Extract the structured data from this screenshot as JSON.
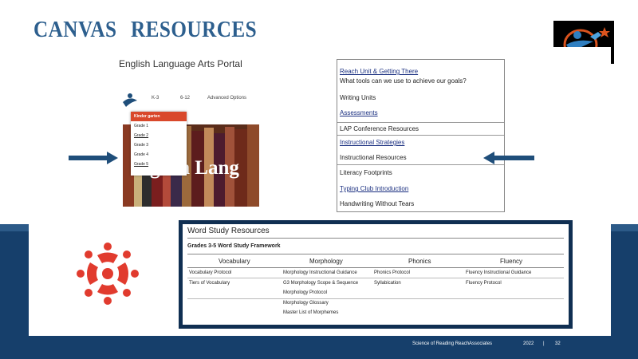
{
  "header": {
    "title_left": "CANVAS",
    "title_right": "RESOURCES"
  },
  "portal": {
    "title": "English Language Arts Portal",
    "nav": [
      "K-3",
      "6-12",
      "Advanced Options"
    ],
    "dropdown_head": "Kinder garten",
    "dropdown_items": [
      "Grade 1",
      "Grade 2",
      "Grade 3",
      "Grade 4",
      "Grade 5"
    ],
    "photo_text": "glish Lang"
  },
  "list": {
    "items": [
      {
        "label": "Reach Unit & Getting There",
        "link": true
      },
      {
        "label": "What tools can we use to achieve our goals?",
        "link": false
      },
      {
        "label": "Writing Units",
        "link": false
      },
      {
        "label": "Assessments",
        "link": true
      },
      {
        "label": "LAP Conference Resources",
        "link": false
      },
      {
        "label": "Instructional Strategies",
        "link": true
      },
      {
        "label": "Instructional Resources",
        "link": false
      },
      {
        "label": "Literacy Footprints",
        "link": false
      },
      {
        "label": "Typing Club Introduction",
        "link": true
      },
      {
        "label": "Handwriting Without Tears",
        "link": false
      }
    ]
  },
  "word_study": {
    "title": "Word Study Resources",
    "subtitle": "Grades 3-5 Word Study Framework",
    "headers": [
      "Vocabulary",
      "Morphology",
      "Phonics",
      "Fluency"
    ],
    "vocabulary": [
      "Vocabulary Protocol",
      "Tiers of Vocabulary"
    ],
    "morphology": [
      "Morphology Instructional Guidance",
      "G3 Morphology Scope & Sequence",
      "Morphology Protocol",
      "Morphology Glossary",
      "Master List of Morphemes"
    ],
    "phonics": [
      "Phonics Protocol",
      "Syllabication"
    ],
    "fluency": [
      "Fluency Instructional Guidance",
      "Fluency Protocol"
    ]
  },
  "footer": {
    "org": "Science of Reading ReachAssociates",
    "year": "2022",
    "divider": "|",
    "page": "32"
  },
  "colors": {
    "title": "#2d5f8e",
    "band": "#163f6b",
    "canvas_red": "#e13b2e",
    "arrow": "#1f4e7a"
  }
}
